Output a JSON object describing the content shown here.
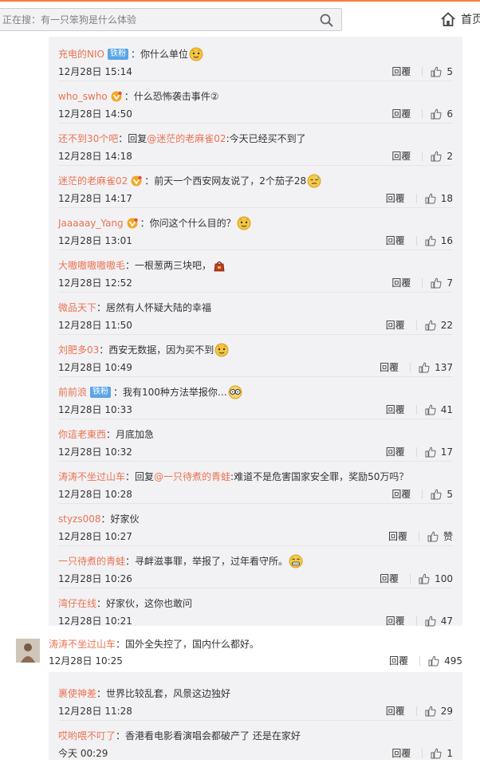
{
  "header": {
    "search_placeholder": "正在搜：有一只笨狗是什么体验",
    "home_label": "首页"
  },
  "replies": [
    {
      "user": "充电的NIO",
      "badge": "铁粉",
      "vip": false,
      "reply_to": "",
      "text": "：你什么单位",
      "emoji": "doge",
      "time": "12月28日 15:14",
      "reply_label": "回覆",
      "likes": "5"
    },
    {
      "user": "who_swho",
      "badge": "",
      "vip": true,
      "reply_to": "",
      "text": "：什么恐怖袭击事件②",
      "emoji": "",
      "time": "12月28日 14:50",
      "reply_label": "回覆",
      "likes": "6"
    },
    {
      "user": "还不到30个吧",
      "badge": "",
      "vip": false,
      "reply_to": "@迷茫的老麻雀02",
      "text": ":今天已经买不到了",
      "emoji": "",
      "time": "12月28日 14:18",
      "reply_label": "回覆",
      "likes": "2"
    },
    {
      "user": "迷茫的老麻雀02",
      "badge": "",
      "vip": true,
      "reply_to": "",
      "text": "：前天一个西安网友说了，2个茄子28",
      "emoji": "sweat",
      "time": "12月28日 14:17",
      "reply_label": "回覆",
      "likes": "18"
    },
    {
      "user": "Jaaaaay_Yang",
      "badge": "",
      "vip": true,
      "reply_to": "",
      "text": "：你问这个什么目的？",
      "emoji": "doge",
      "time": "12月28日 13:01",
      "reply_label": "回覆",
      "likes": "16"
    },
    {
      "user": "大嗷嗷嗷嗷嗷毛",
      "badge": "",
      "vip": false,
      "reply_to": "",
      "text": "：一根葱两三块吧，",
      "emoji": "bag",
      "time": "12月28日 12:52",
      "reply_label": "回覆",
      "likes": "7"
    },
    {
      "user": "微品天下",
      "badge": "",
      "vip": false,
      "reply_to": "",
      "text": "：居然有人怀疑大陆的幸福",
      "emoji": "",
      "time": "12月28日 11:50",
      "reply_label": "回覆",
      "likes": "22"
    },
    {
      "user": "刘肥多03",
      "badge": "",
      "vip": false,
      "reply_to": "",
      "text": "：西安无数据，因为买不到",
      "emoji": "doge",
      "time": "12月28日 10:49",
      "reply_label": "回覆",
      "likes": "137"
    },
    {
      "user": "前前浪",
      "badge": "铁粉",
      "vip": false,
      "reply_to": "",
      "text": "：我有100种方法举报你…",
      "emoji": "glasses",
      "time": "12月28日 10:33",
      "reply_label": "回覆",
      "likes": "41"
    },
    {
      "user": "你這老東西",
      "badge": "",
      "vip": false,
      "reply_to": "",
      "text": "：月底加急",
      "emoji": "",
      "time": "12月28日 10:32",
      "reply_label": "回覆",
      "likes": "17"
    },
    {
      "user": "涛涛不坐过山车",
      "badge": "",
      "vip": false,
      "reply_to": "@一只待煮的青蛙",
      "text": ":难道不是危害国家安全罪，奖励50万吗？",
      "emoji": "",
      "time": "12月28日 10:28",
      "reply_label": "回覆",
      "likes": "5"
    },
    {
      "user": "styzs008",
      "badge": "",
      "vip": false,
      "reply_to": "",
      "text": "：好家伙",
      "emoji": "",
      "time": "12月28日 10:27",
      "reply_label": "回覆",
      "likes": "赞"
    },
    {
      "user": "一只待煮的青蛙",
      "badge": "",
      "vip": false,
      "reply_to": "",
      "text": "：寻衅滋事罪，举报了，过年看守所。",
      "emoji": "grin",
      "time": "12月28日 10:26",
      "reply_label": "回覆",
      "likes": "100"
    },
    {
      "user": "湾仔在线",
      "badge": "",
      "vip": false,
      "reply_to": "",
      "text": "：好家伙，这你也敢问",
      "emoji": "",
      "time": "12月28日 10:21",
      "reply_label": "回覆",
      "likes": "47"
    }
  ],
  "top_comment": {
    "user": "涛涛不坐过山车",
    "text": "：国外全失控了，国内什么都好。",
    "time": "12月28日 10:25",
    "reply_label": "回覆",
    "likes": "495"
  },
  "replies2": [
    {
      "user": "裹使神差",
      "badge": "",
      "vip": false,
      "reply_to": "",
      "text": "：世界比较乱套，风景这边独好",
      "emoji": "",
      "time": "12月28日 11:28",
      "reply_label": "回覆",
      "likes": "29"
    },
    {
      "user": "哎哟喂不叮了",
      "badge": "",
      "vip": false,
      "reply_to": "",
      "text": "：香港看电影看演唱会都破产了 还是在家好",
      "emoji": "",
      "time": "今天 00:29",
      "reply_label": "回覆",
      "likes": "1"
    }
  ],
  "reply_prefix": "：回复",
  "colors": {
    "accent": "#fa7d3c",
    "username": "#eb7350",
    "badge": "#5aa5e7",
    "reply_bg": "#f2f2f5"
  }
}
